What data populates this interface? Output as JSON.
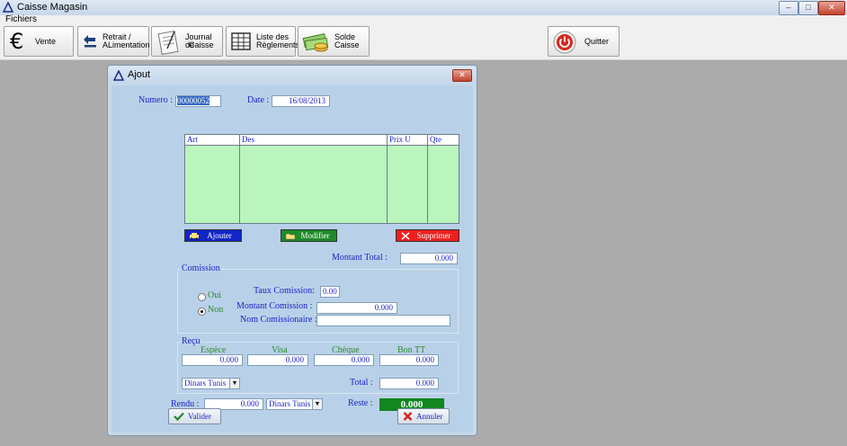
{
  "window": {
    "title": "Caisse Magasin"
  },
  "menu": {
    "fichiers": "Fichiers"
  },
  "toolbar": {
    "vente": "Vente",
    "retrait_l1": "Retrait /",
    "retrait_l2": "ALimentation",
    "journal_l1": "Journal de",
    "journal_l2": "Caisse",
    "liste_l1": "Liste des",
    "liste_l2": "Règlements",
    "solde_l1": "Solde",
    "solde_l2": "Caisse",
    "quitter": "Quitter"
  },
  "dialog": {
    "title": "Ajout",
    "numero_label": "Numero :",
    "numero_value": "00000052",
    "date_label": "Date :",
    "date_value": "16/08/2013",
    "grid": {
      "columns": [
        "Art",
        "Des",
        "Prix U",
        "Qte"
      ],
      "rows": []
    },
    "ajouter": "Ajouter",
    "modifier": "Modifier",
    "supprimer": "Supprimer",
    "montant_total_label": "Montant Total :",
    "montant_total_value": "0.000",
    "comission": {
      "title": "Comission",
      "oui": "Oui",
      "non": "Non",
      "selected": "Non",
      "taux_label": "Taux Comission:",
      "taux_value": "0.00",
      "montant_label": "Montant Comission :",
      "montant_value": "0.000",
      "nom_label": "Nom Comissionaire :",
      "nom_value": ""
    },
    "recu": {
      "title": "Reçu",
      "espece_label": "Espèce",
      "espece_value": "0.000",
      "visa_label": "Visa",
      "visa_value": "0.000",
      "cheque_label": "Chèque",
      "cheque_value": "0.000",
      "bon_label": "Bon TT",
      "bon_value": "0.000",
      "devise": "Dinars Tunis",
      "total_label": "Total :",
      "total_value": "0.000"
    },
    "rendu_label": "Rendu :",
    "rendu_value": "0.000",
    "rendu_devise": "Dinars Tunis",
    "reste_label": "Reste :",
    "reste_value": "0.000",
    "valider": "Valider",
    "annuler": "Annuler"
  },
  "colors": {
    "grid_bg": "#b9f5bd",
    "ajouter_bg": "#1226c8",
    "modifier_bg": "#1e8a2a",
    "supprimer_bg": "#ee1f1f",
    "reste_bg": "#12861f"
  }
}
